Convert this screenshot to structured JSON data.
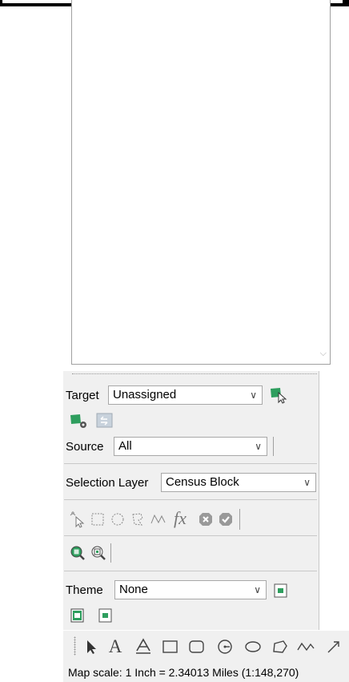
{
  "target": {
    "label": "Target",
    "value": "Unassigned"
  },
  "source": {
    "label": "Source",
    "value": "All"
  },
  "selection_layer": {
    "label": "Selection Layer",
    "value": "Census Block"
  },
  "theme": {
    "label": "Theme",
    "value": "None"
  },
  "status_bar": {
    "map_scale": "Map scale: 1 Inch = 2.34013 Miles (1:148,270)"
  },
  "colors": {
    "accent_green": "#2e9e5e",
    "panel_bg": "#f0f0f0",
    "border": "#a8a8a8"
  },
  "icons": {
    "selection_tools": [
      "pointer-select-icon",
      "rectangle-select-icon",
      "circle-select-icon",
      "lasso-select-icon",
      "line-select-icon",
      "function-select-icon",
      "clear-selection-icon",
      "accept-selection-icon"
    ],
    "zoom_tools": [
      "zoom-to-selection-icon",
      "zoom-to-extent-icon"
    ],
    "draw_tools": [
      "arrow-draw-icon",
      "text-draw-icon",
      "outlined-text-draw-icon",
      "rectangle-draw-icon",
      "rounded-rectangle-draw-icon",
      "circle-draw-icon",
      "ellipse-draw-icon",
      "polygon-draw-icon",
      "freehand-draw-icon",
      "line-draw-icon"
    ]
  },
  "tool_glyphs": {
    "function": "fx",
    "text_draw": "A"
  }
}
